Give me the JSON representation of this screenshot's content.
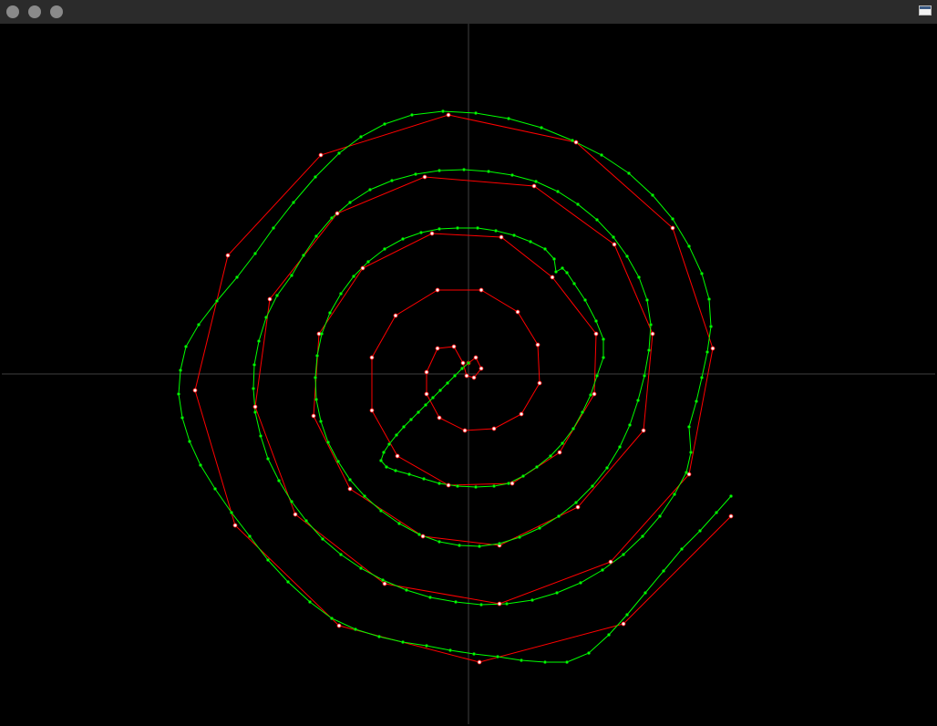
{
  "window": {
    "title_buttons": [
      "close",
      "minimize",
      "zoom"
    ],
    "maximize_icon": "window-maximize-icon"
  },
  "colors": {
    "background": "#000000",
    "titlebar": "#2b2b2b",
    "axes": "#404040",
    "control_polygon": "#ff0000",
    "curve": "#00ff00",
    "control_point_fill": "#ffffff",
    "curve_point_fill": "#00ff00"
  },
  "plot": {
    "axes": "crosshair",
    "control_polygon_present": true,
    "smooth_curve_present": true
  }
}
